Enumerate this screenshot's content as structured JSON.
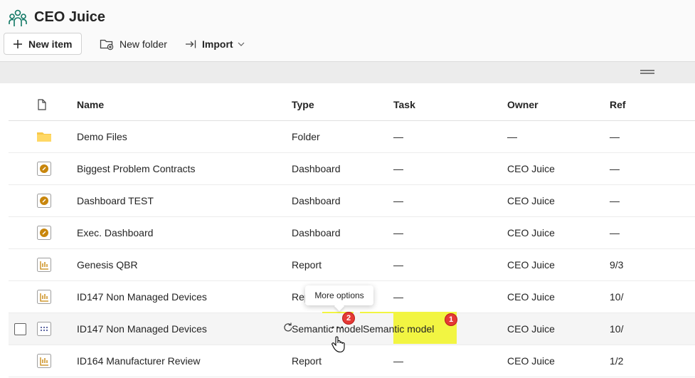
{
  "workspace": {
    "title": "CEO Juice",
    "icon": "workspace-people-icon"
  },
  "toolbar": {
    "new_item_label": "New item",
    "new_folder_label": "New folder",
    "import_label": "Import"
  },
  "table": {
    "headers": {
      "name": "Name",
      "type": "Type",
      "task": "Task",
      "owner": "Owner",
      "refreshed": "Ref"
    },
    "rows": [
      {
        "icon": "folder-icon",
        "name": "Demo Files",
        "type": "Folder",
        "task": "—",
        "owner": "—",
        "refreshed": "—"
      },
      {
        "icon": "dashboard-icon",
        "name": "Biggest Problem Contracts",
        "type": "Dashboard",
        "task": "—",
        "owner": "CEO Juice",
        "refreshed": "—"
      },
      {
        "icon": "dashboard-icon",
        "name": "Dashboard TEST",
        "type": "Dashboard",
        "task": "—",
        "owner": "CEO Juice",
        "refreshed": "—"
      },
      {
        "icon": "dashboard-icon",
        "name": "Exec. Dashboard",
        "type": "Dashboard",
        "task": "—",
        "owner": "CEO Juice",
        "refreshed": "—"
      },
      {
        "icon": "report-icon",
        "name": "Genesis QBR",
        "type": "Report",
        "task": "—",
        "owner": "CEO Juice",
        "refreshed": "9/3"
      },
      {
        "icon": "report-icon",
        "name": "ID147 Non Managed Devices",
        "type": "Report",
        "task": "—",
        "owner": "CEO Juice",
        "refreshed": "10/"
      },
      {
        "icon": "semantic-model-icon",
        "name": "ID147 Non Managed Devices",
        "type": "Semantic model",
        "task": "—",
        "owner": "CEO Juice",
        "refreshed": "10/"
      },
      {
        "icon": "report-icon",
        "name": "ID164 Manufacturer Review",
        "type": "Report",
        "task": "—",
        "owner": "CEO Juice",
        "refreshed": "1/2"
      }
    ]
  },
  "tooltip": {
    "text": "More options"
  },
  "annotations": {
    "badge_1": "1",
    "badge_2": "2"
  },
  "more_options_glyph": "···",
  "colors": {
    "highlight": "#f2f542",
    "badge": "#e53935",
    "dashboard": "#c8860c",
    "folder": "#f8c84a"
  }
}
